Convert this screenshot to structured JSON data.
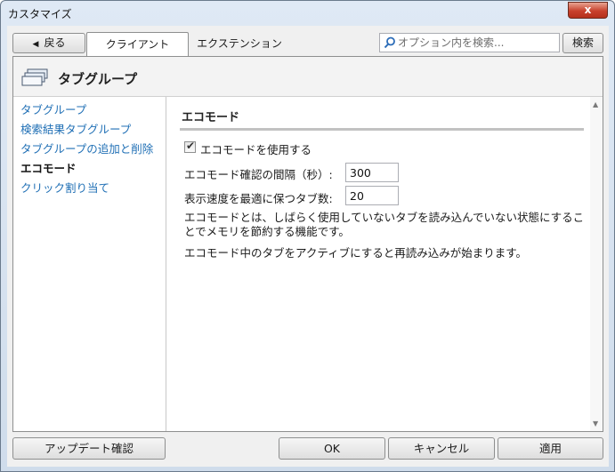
{
  "window": {
    "title": "カスタマイズ",
    "close_glyph": "x"
  },
  "toolbar": {
    "back_label": "戻る",
    "tabs": [
      {
        "label": "クライアント",
        "active": true
      },
      {
        "label": "エクステンション",
        "active": false
      }
    ],
    "search": {
      "placeholder": "オプション内を検索...",
      "value": ""
    },
    "search_button": "検索"
  },
  "panel": {
    "title": "タブグループ",
    "icon": "tab-group-icon"
  },
  "sidebar": {
    "items": [
      {
        "label": "タブグループ",
        "active": false
      },
      {
        "label": "検索結果タブグループ",
        "active": false
      },
      {
        "label": "タブグループの追加と削除",
        "active": false
      },
      {
        "label": "エコモード",
        "active": true
      },
      {
        "label": "クリック割り当て",
        "active": false
      }
    ]
  },
  "content": {
    "section_title": "エコモード",
    "checkbox": {
      "label": "エコモードを使用する",
      "checked": true
    },
    "interval": {
      "label": "エコモード確認の間隔（秒）:",
      "value": "300"
    },
    "tab_count": {
      "label": "表示速度を最適に保つタブ数:",
      "value": "20"
    },
    "description_1": "エコモードとは、しばらく使用していないタブを読み込んでいない状態にすることでメモリを節約する機能です。",
    "description_2": "エコモード中のタブをアクティブにすると再読み込みが始まります。"
  },
  "buttons": {
    "update": "アップデート確認",
    "ok": "OK",
    "cancel": "キャンセル",
    "apply": "適用"
  },
  "colors": {
    "link": "#1f6fb5",
    "close_button": "#c8412c",
    "frame": "#cfdceb"
  }
}
